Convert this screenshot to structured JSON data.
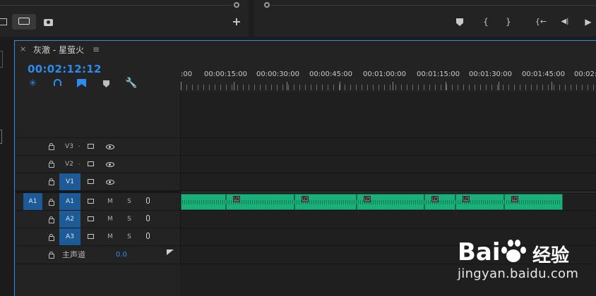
{
  "colors": {
    "accent": "#2d8ceb",
    "audio_clip": "#1bb07a",
    "track_button": "#1d5a96"
  },
  "top_left": {
    "add_symbol": "+"
  },
  "top_right": {
    "marker_icon": "marker-icon",
    "in_brace": "{",
    "out_brace": "}",
    "go_in_label": "{←",
    "step_back_label": "◀|",
    "play_label": "▶"
  },
  "timeline": {
    "close_label": "×",
    "sequence_title": "灰澈 - 星萤火",
    "menu_label": "≡",
    "timecode": "00:02:12:12",
    "ruler": [
      ":00",
      "00:00:15:00",
      "00:00:30:00",
      "00:00:45:00",
      "00:01:00:00",
      "00:01:15:00",
      "00:01:30:00",
      "00:01:45:00",
      "00:02:0"
    ],
    "video_tracks": [
      {
        "name": "V3",
        "dot": ".",
        "active": false
      },
      {
        "name": "V2",
        "dot": ".",
        "active": false
      },
      {
        "name": "V1",
        "dot": "",
        "active": true
      }
    ],
    "audio_tracks": [
      {
        "source": "A1",
        "name": "A1",
        "m": "M",
        "s": "S"
      },
      {
        "source": "",
        "name": "A2",
        "m": "M",
        "s": "S"
      },
      {
        "source": "",
        "name": "A3",
        "m": "M",
        "s": "S"
      }
    ],
    "master": {
      "label": "主声道",
      "value": "0.0"
    },
    "fx_label": "fx"
  },
  "watermark": {
    "brand": "Bai",
    "brand2": "du",
    "cn": "经验",
    "url": "jingyan.baidu.com"
  }
}
